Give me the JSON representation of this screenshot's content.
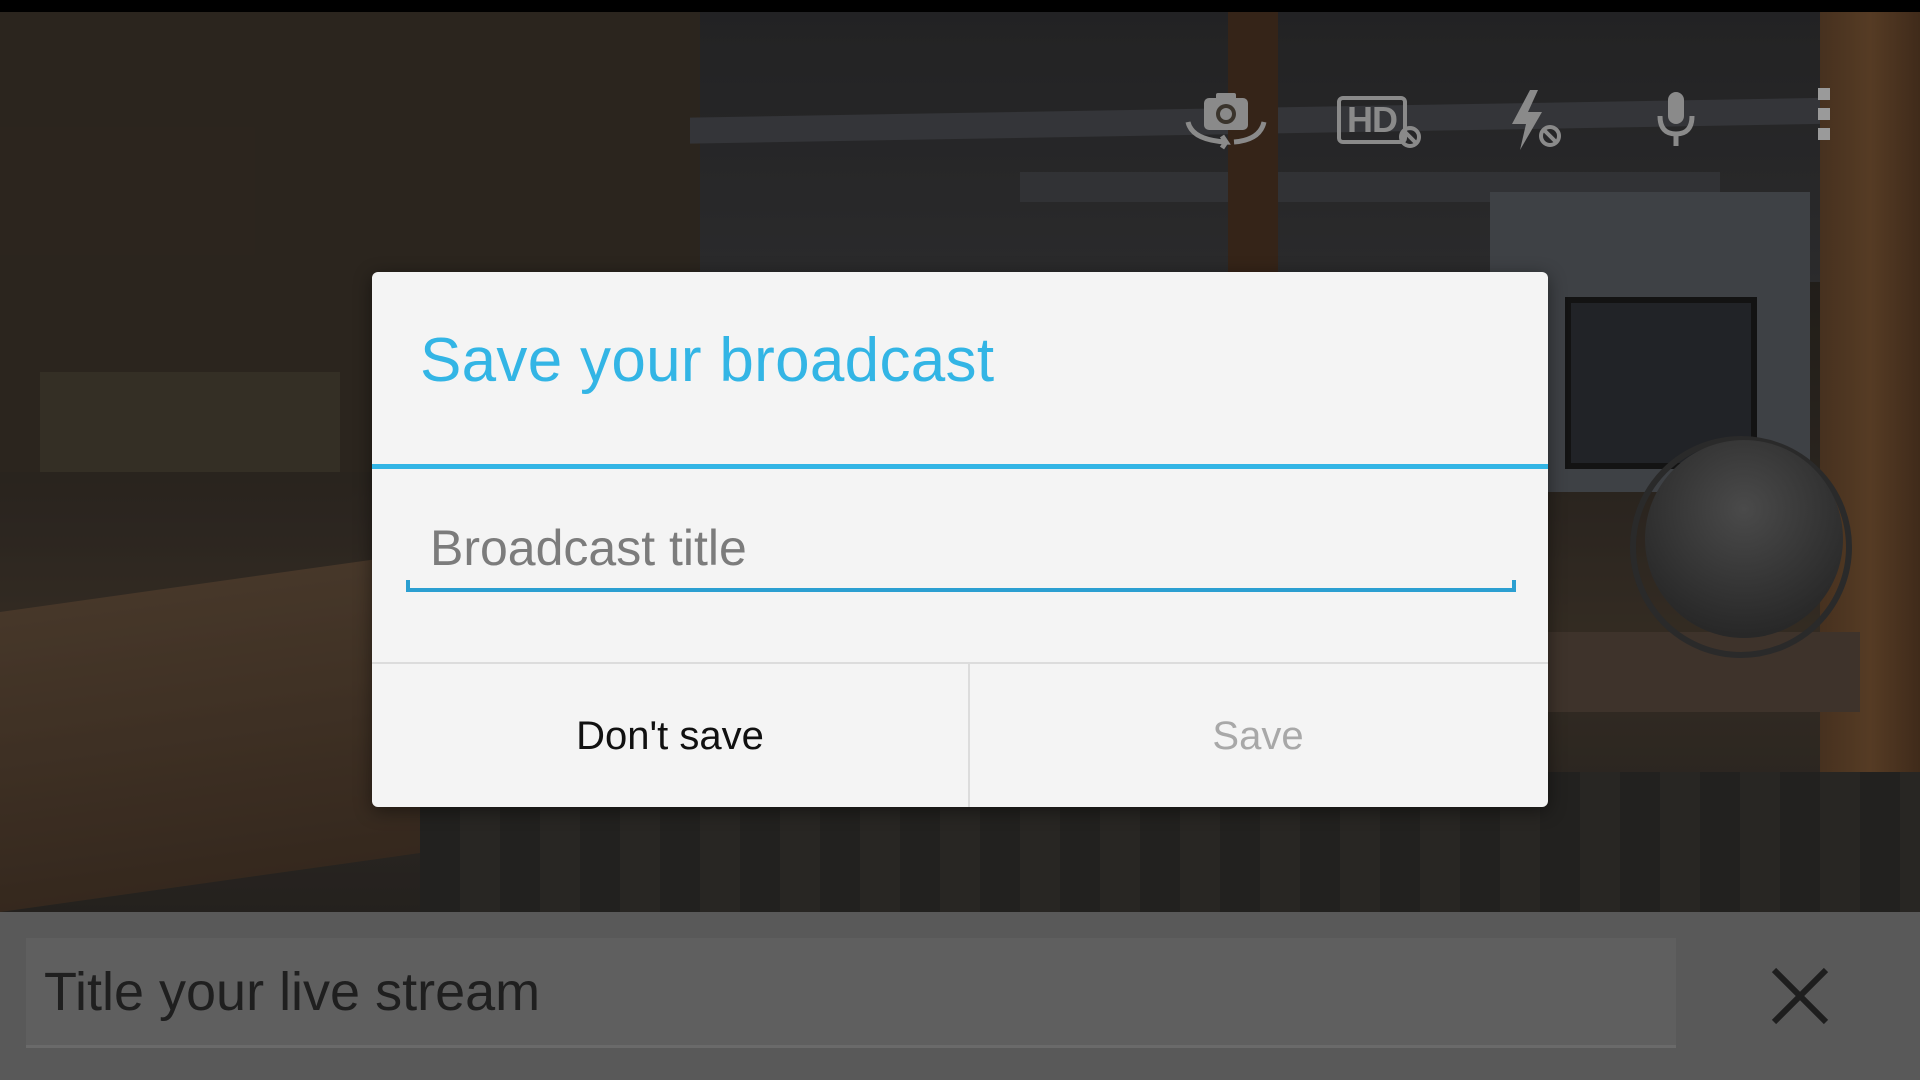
{
  "dialog": {
    "title": "Save your broadcast",
    "input_placeholder": "Broadcast title",
    "input_value": "",
    "dont_save_label": "Don't save",
    "save_label": "Save"
  },
  "controls": {
    "hd_label": "HD",
    "icons": [
      "switch-camera-icon",
      "hd-off-icon",
      "flash-off-icon",
      "microphone-icon",
      "overflow-menu-icon",
      "close-icon"
    ]
  },
  "bottom_bar": {
    "input_placeholder": "Title your live stream",
    "input_value": ""
  },
  "colors": {
    "accent": "#33b5e5",
    "dialog_bg": "#f4f4f4",
    "disabled_text": "#a8a8a8"
  }
}
